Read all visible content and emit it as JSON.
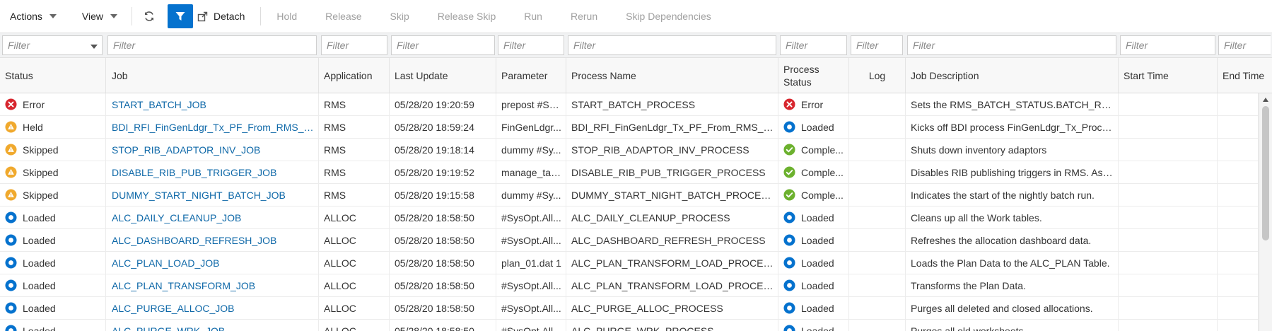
{
  "toolbar": {
    "actions_label": "Actions",
    "view_label": "View",
    "refresh_icon": "refresh-icon",
    "filter_icon": "filter-icon",
    "detach_label": "Detach",
    "hold_label": "Hold",
    "release_label": "Release",
    "skip_label": "Skip",
    "release_skip_label": "Release Skip",
    "run_label": "Run",
    "rerun_label": "Rerun",
    "skip_dependencies_label": "Skip Dependencies"
  },
  "filters": {
    "placeholder": "Filter",
    "status_value": ""
  },
  "columns": {
    "status": "Status",
    "job": "Job",
    "application": "Application",
    "last_update": "Last Update",
    "parameter": "Parameter",
    "process_name": "Process Name",
    "process_status_line1": "Process",
    "process_status_line2": "Status",
    "log": "Log",
    "job_description": "Job Description",
    "start_time": "Start Time",
    "end_time": "End Time"
  },
  "status_colors": {
    "error": "#d7262e",
    "held": "#f0a92d",
    "skipped": "#f0a92d",
    "loaded": "#0572ce",
    "completed": "#6cb12e"
  },
  "rows": [
    {
      "status": "Error",
      "status_icon": "error-icon",
      "job": "START_BATCH_JOB",
      "application": "RMS",
      "last_update": "05/28/20 19:20:59",
      "parameter": "prepost #Sy...",
      "process_name": "START_BATCH_PROCESS",
      "process_status": "Error",
      "process_status_icon": "error-icon",
      "log": "",
      "job_description": "Sets the RMS_BATCH_STATUS.BATCH_RUNN...",
      "start_time": "",
      "end_time": ""
    },
    {
      "status": "Held",
      "status_icon": "warning-icon",
      "job": "BDI_RFI_FinGenLdgr_Tx_PF_From_RMS_JOB",
      "application": "RMS",
      "last_update": "05/28/20 18:59:24",
      "parameter": "FinGenLdgr...",
      "process_name": "BDI_RFI_FinGenLdgr_Tx_PF_From_RMS_PRO...",
      "process_status": "Loaded",
      "process_status_icon": "loaded-icon",
      "log": "",
      "job_description": "Kicks off BDI process FinGenLdgr_Tx_Process...",
      "start_time": "",
      "end_time": ""
    },
    {
      "status": "Skipped",
      "status_icon": "warning-icon",
      "job": "STOP_RIB_ADAPTOR_INV_JOB",
      "application": "RMS",
      "last_update": "05/28/20 19:18:14",
      "parameter": "dummy #Sy...",
      "process_name": "STOP_RIB_ADAPTOR_INV_PROCESS",
      "process_status": "Comple...",
      "process_status_icon": "check-icon",
      "log": "",
      "job_description": "Shuts down inventory adaptors",
      "start_time": "",
      "end_time": ""
    },
    {
      "status": "Skipped",
      "status_icon": "warning-icon",
      "job": "DISABLE_RIB_PUB_TRIGGER_JOB",
      "application": "RMS",
      "last_update": "05/28/20 19:19:52",
      "parameter": "manage_tab...",
      "process_name": "DISABLE_RIB_PUB_TRIGGER_PROCESS",
      "process_status": "Comple...",
      "process_status_icon": "check-icon",
      "log": "",
      "job_description": "Disables RIB publishing triggers in RMS. As o...",
      "start_time": "",
      "end_time": ""
    },
    {
      "status": "Skipped",
      "status_icon": "warning-icon",
      "job": "DUMMY_START_NIGHT_BATCH_JOB",
      "application": "RMS",
      "last_update": "05/28/20 19:15:58",
      "parameter": "dummy #Sy...",
      "process_name": "DUMMY_START_NIGHT_BATCH_PROCESS",
      "process_status": "Comple...",
      "process_status_icon": "check-icon",
      "log": "",
      "job_description": "Indicates the start of the nightly batch run.",
      "start_time": "",
      "end_time": ""
    },
    {
      "status": "Loaded",
      "status_icon": "loaded-icon",
      "job": "ALC_DAILY_CLEANUP_JOB",
      "application": "ALLOC",
      "last_update": "05/28/20 18:58:50",
      "parameter": "#SysOpt.All...",
      "process_name": "ALC_DAILY_CLEANUP_PROCESS",
      "process_status": "Loaded",
      "process_status_icon": "loaded-icon",
      "log": "",
      "job_description": "Cleans up all the Work tables.",
      "start_time": "",
      "end_time": ""
    },
    {
      "status": "Loaded",
      "status_icon": "loaded-icon",
      "job": "ALC_DASHBOARD_REFRESH_JOB",
      "application": "ALLOC",
      "last_update": "05/28/20 18:58:50",
      "parameter": "#SysOpt.All...",
      "process_name": "ALC_DASHBOARD_REFRESH_PROCESS",
      "process_status": "Loaded",
      "process_status_icon": "loaded-icon",
      "log": "",
      "job_description": "Refreshes the allocation dashboard data.",
      "start_time": "",
      "end_time": ""
    },
    {
      "status": "Loaded",
      "status_icon": "loaded-icon",
      "job": "ALC_PLAN_LOAD_JOB",
      "application": "ALLOC",
      "last_update": "05/28/20 18:58:50",
      "parameter": "plan_01.dat 1",
      "process_name": "ALC_PLAN_TRANSFORM_LOAD_PROCESS",
      "process_status": "Loaded",
      "process_status_icon": "loaded-icon",
      "log": "",
      "job_description": "Loads the Plan Data to the ALC_PLAN Table.",
      "start_time": "",
      "end_time": ""
    },
    {
      "status": "Loaded",
      "status_icon": "loaded-icon",
      "job": "ALC_PLAN_TRANSFORM_JOB",
      "application": "ALLOC",
      "last_update": "05/28/20 18:58:50",
      "parameter": "#SysOpt.All...",
      "process_name": "ALC_PLAN_TRANSFORM_LOAD_PROCESS",
      "process_status": "Loaded",
      "process_status_icon": "loaded-icon",
      "log": "",
      "job_description": "Transforms the Plan Data.",
      "start_time": "",
      "end_time": ""
    },
    {
      "status": "Loaded",
      "status_icon": "loaded-icon",
      "job": "ALC_PURGE_ALLOC_JOB",
      "application": "ALLOC",
      "last_update": "05/28/20 18:58:50",
      "parameter": "#SysOpt.All...",
      "process_name": "ALC_PURGE_ALLOC_PROCESS",
      "process_status": "Loaded",
      "process_status_icon": "loaded-icon",
      "log": "",
      "job_description": "Purges all deleted and closed allocations.",
      "start_time": "",
      "end_time": ""
    },
    {
      "status": "Loaded",
      "status_icon": "loaded-icon",
      "job": "ALC_PURGE_WRK_JOB",
      "application": "ALLOC",
      "last_update": "05/28/20 18:58:50",
      "parameter": "#SysOpt.All...",
      "process_name": "ALC_PURGE_WRK_PROCESS",
      "process_status": "Loaded",
      "process_status_icon": "loaded-icon",
      "log": "",
      "job_description": "Purges all old worksheets.",
      "start_time": "",
      "end_time": ""
    }
  ]
}
